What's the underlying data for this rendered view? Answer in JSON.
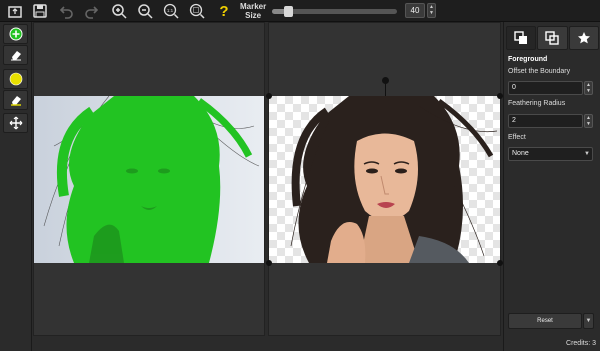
{
  "toolbar": {
    "icons": [
      "open-icon",
      "save-icon",
      "undo-icon",
      "redo-icon",
      "zoom-in-icon",
      "zoom-out-icon",
      "actual-size-icon",
      "fit-icon",
      "help-icon"
    ],
    "actual_size_glyph": "1:1",
    "help_glyph": "?",
    "marker_label_line1": "Marker",
    "marker_label_line2": "Size",
    "marker_size_value": "40",
    "marker_size_fraction": 0.13
  },
  "left_tools": [
    "add-foreground-icon",
    "eraser-icon",
    "background-marker-icon",
    "eraser-background-icon",
    "move-icon"
  ],
  "right_panel": {
    "tabs": [
      "foreground-tab-icon",
      "copy-tab-icon",
      "star-tab-icon"
    ],
    "section_title": "Foreground",
    "offset_label": "Offset the Boundary",
    "offset_value": "0",
    "feather_label": "Feathering Radius",
    "feather_value": "2",
    "effect_label": "Effect",
    "effect_value": "None",
    "reset_label": "Reset",
    "credits": "Credits: 3"
  },
  "colors": {
    "accent_green": "#22c322",
    "marker_yellow": "#e8e000",
    "help_yellow": "#f0d000"
  }
}
